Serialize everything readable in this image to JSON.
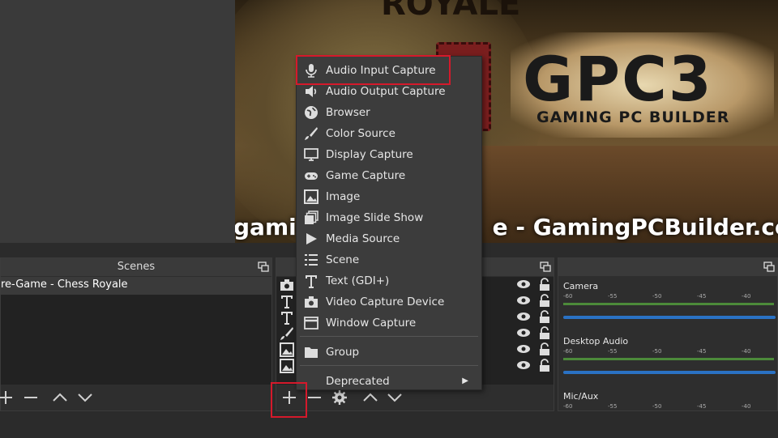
{
  "preview": {
    "logo_text": "GPC3",
    "logo_subtext": "GAMING PC BUILDER",
    "caption_visible": "gamin",
    "caption_right": "e - GamingPCBuilder.com"
  },
  "scenes": {
    "title": "Scenes",
    "items": [
      "re-Game - Chess Royale"
    ]
  },
  "sources": {
    "rows": [
      "camera-source-icon",
      "text-source-icon",
      "text-source-icon",
      "brush-source-icon",
      "image-source-icon",
      "image-source-icon"
    ]
  },
  "mixer": {
    "ticks": [
      "-60",
      "-55",
      "-50",
      "-45",
      "-40"
    ],
    "channels": [
      {
        "name": "Camera"
      },
      {
        "name": "Desktop Audio"
      },
      {
        "name": "Mic/Aux"
      }
    ]
  },
  "menu": {
    "items": [
      {
        "label": "Audio Input Capture",
        "icon": "microphone-icon"
      },
      {
        "label": "Audio Output Capture",
        "icon": "speaker-icon"
      },
      {
        "label": "Browser",
        "icon": "globe-icon"
      },
      {
        "label": "Color Source",
        "icon": "paintbrush-icon"
      },
      {
        "label": "Display Capture",
        "icon": "monitor-icon"
      },
      {
        "label": "Game Capture",
        "icon": "gamepad-icon"
      },
      {
        "label": "Image",
        "icon": "image-icon"
      },
      {
        "label": "Image Slide Show",
        "icon": "slideshow-icon"
      },
      {
        "label": "Media Source",
        "icon": "play-icon"
      },
      {
        "label": "Scene",
        "icon": "list-icon"
      },
      {
        "label": "Text (GDI+)",
        "icon": "text-icon"
      },
      {
        "label": "Video Capture Device",
        "icon": "camera-icon"
      },
      {
        "label": "Window Capture",
        "icon": "window-icon"
      }
    ],
    "group_label": "Group",
    "deprecated_label": "Deprecated"
  },
  "colors": {
    "highlight": "#d5192b",
    "fader": "#2a72c4",
    "meter": "#4c8a3a"
  }
}
